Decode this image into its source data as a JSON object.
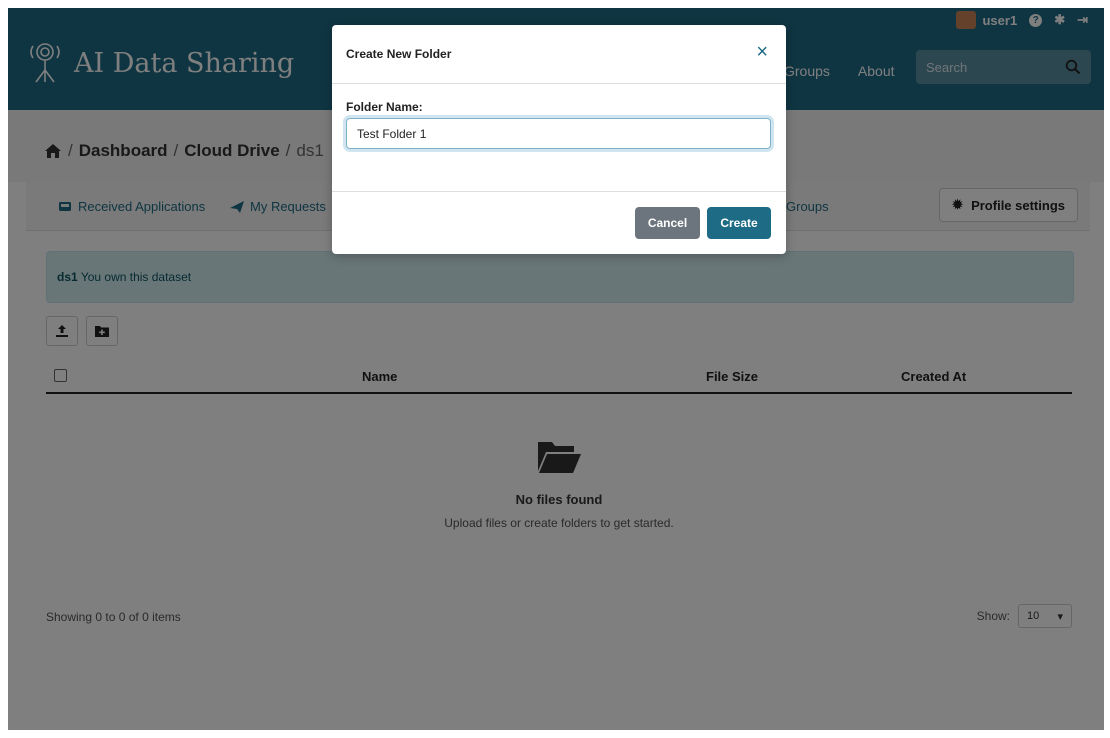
{
  "top_bar": {
    "username": "user1"
  },
  "header": {
    "brand": "AI Data Sharing",
    "nav": [
      "Groups",
      "About"
    ],
    "search_placeholder": "Search"
  },
  "breadcrumb": {
    "items": [
      "Dashboard",
      "Cloud Drive",
      "ds1"
    ]
  },
  "tabs": {
    "items": [
      "Received Applications",
      "My Requests",
      "Groups"
    ],
    "profile_settings": "Profile settings"
  },
  "info": {
    "dataset": "ds1",
    "text": "You own this dataset"
  },
  "table": {
    "columns": [
      "Name",
      "File Size",
      "Created At"
    ],
    "empty_title": "No files found",
    "empty_subtitle": "Upload files or create folders to get started."
  },
  "footer": {
    "showing": "Showing 0 to 0 of 0 items",
    "show_label": "Show:",
    "page_size": "10"
  },
  "modal": {
    "title": "Create New Folder",
    "folder_label": "Folder Name:",
    "folder_value": "Test Folder 1",
    "cancel": "Cancel",
    "create": "Create"
  },
  "colors": {
    "brand": "#1e6b85",
    "info_bg": "#d1ecf1",
    "cancel_bg": "#6c757d"
  }
}
